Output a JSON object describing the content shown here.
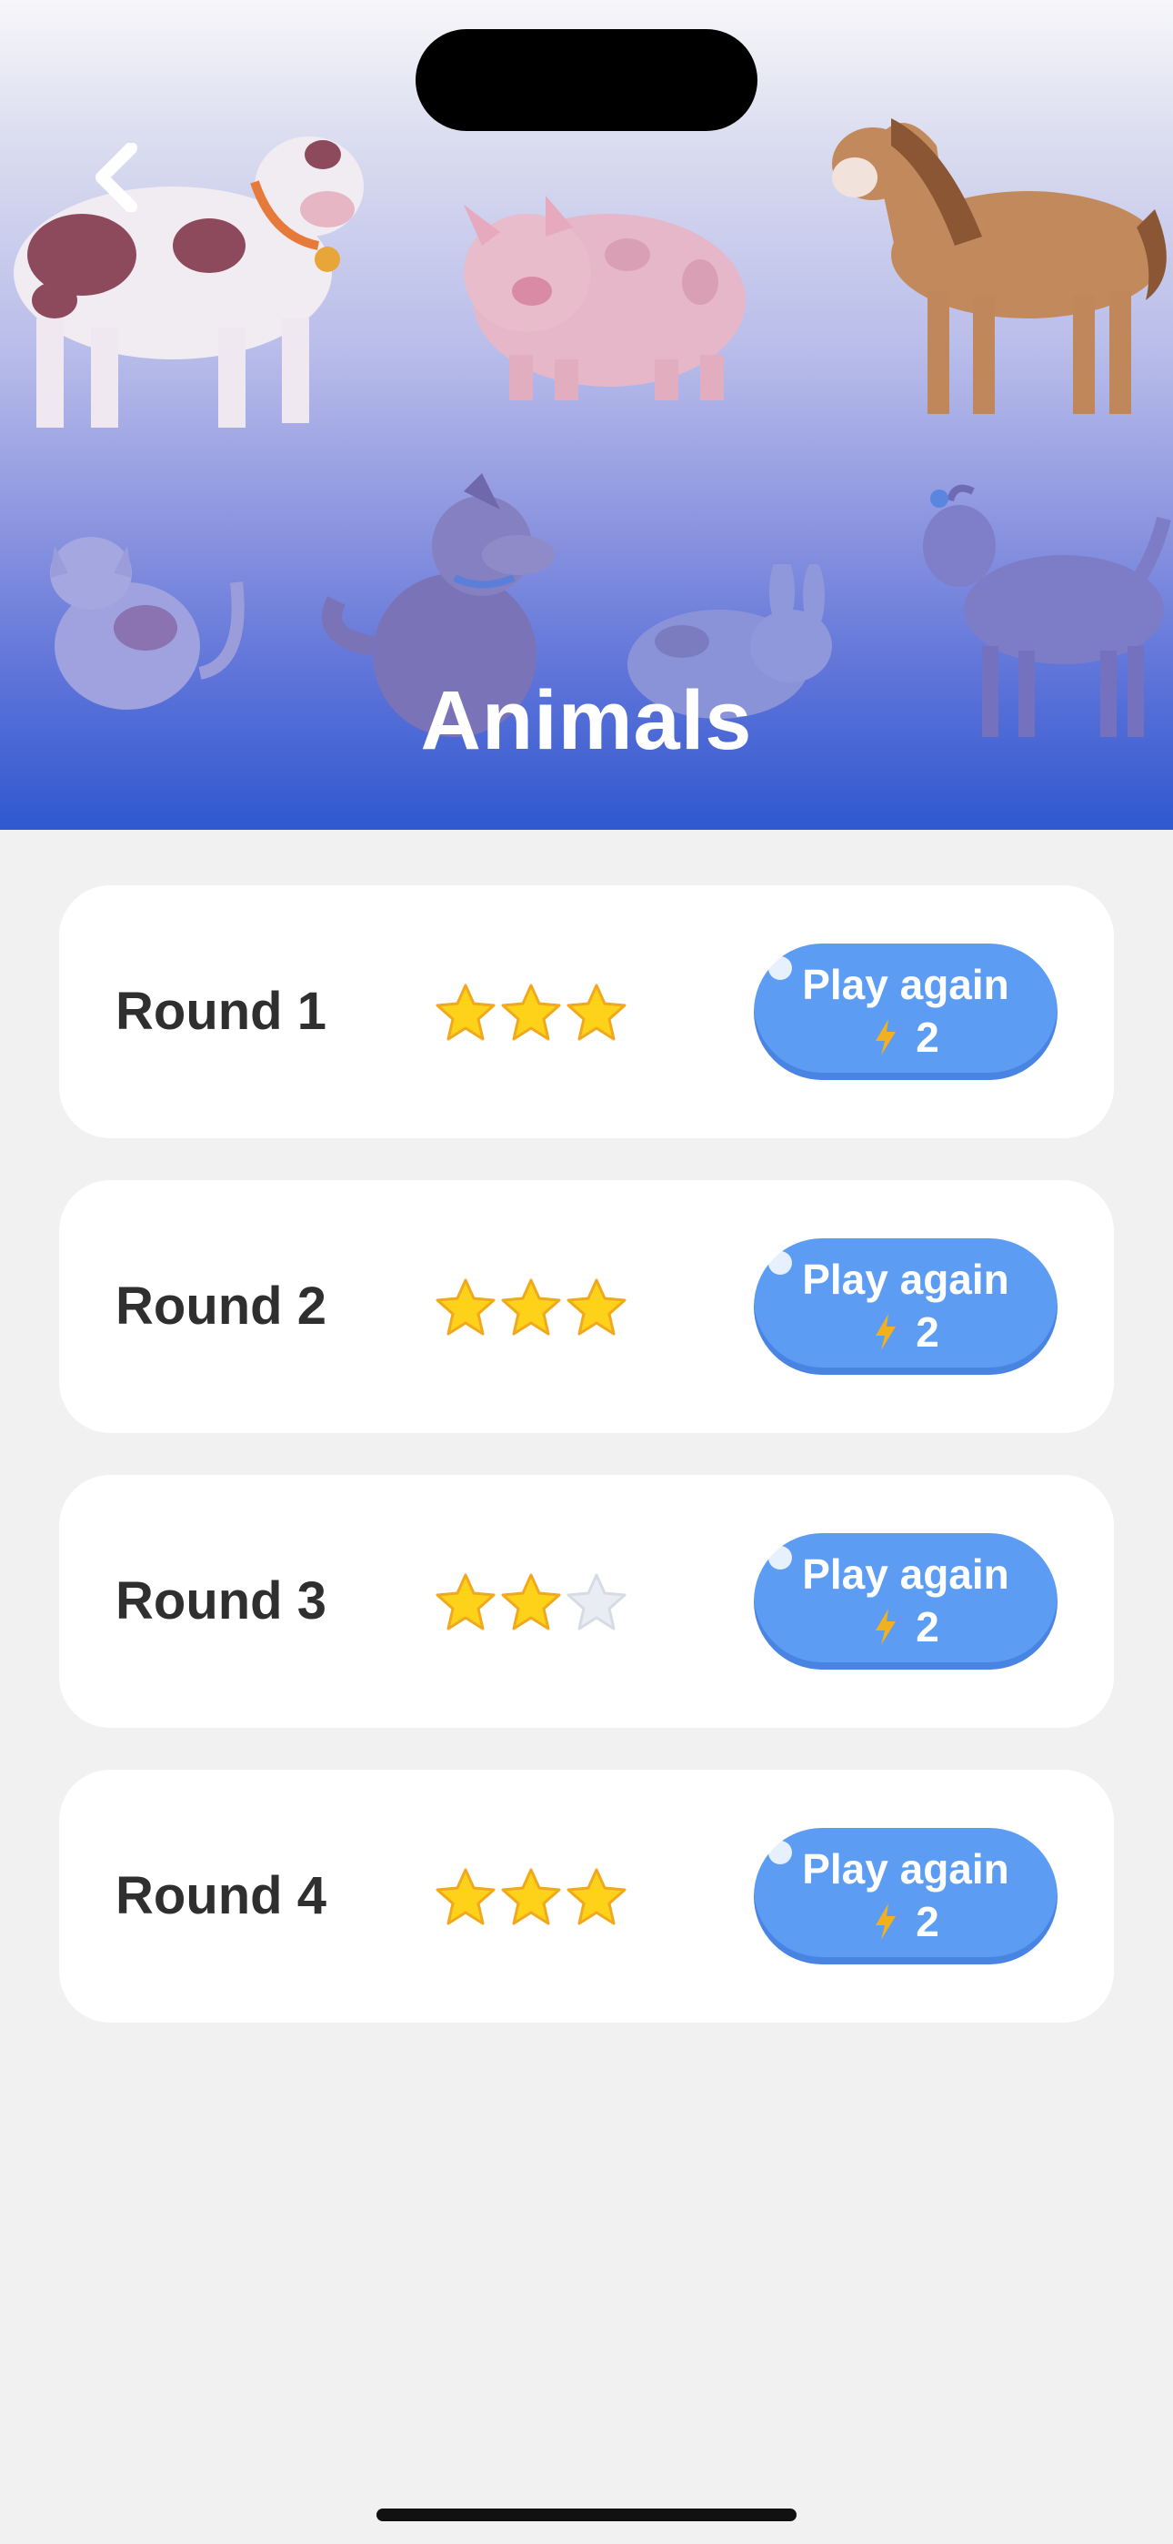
{
  "header": {
    "title": "Animals"
  },
  "rounds": [
    {
      "label": "Round 1",
      "stars": 3,
      "max_stars": 3,
      "button_label": "Play again",
      "cost": "2"
    },
    {
      "label": "Round 2",
      "stars": 3,
      "max_stars": 3,
      "button_label": "Play again",
      "cost": "2"
    },
    {
      "label": "Round 3",
      "stars": 2,
      "max_stars": 3,
      "button_label": "Play again",
      "cost": "2"
    },
    {
      "label": "Round 4",
      "stars": 3,
      "max_stars": 3,
      "button_label": "Play again",
      "cost": "2"
    }
  ],
  "icons": {
    "back": "chevron-left-icon",
    "star_filled": "star-filled-icon",
    "star_empty": "star-empty-icon",
    "energy": "lightning-bolt-icon"
  },
  "colors": {
    "header_top": "#f7f7f9",
    "header_bottom": "#2f58cf",
    "button": "#5c9cf2",
    "star_filled": "#ffd21a",
    "star_empty": "#e9edf3",
    "bolt": "#f2b01e",
    "page_bg": "#f1f1f2"
  }
}
